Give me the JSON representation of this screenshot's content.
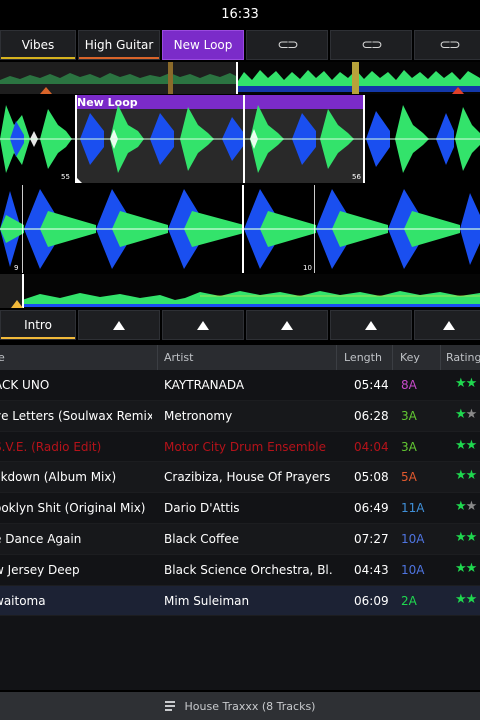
{
  "status": {
    "time": "16:33"
  },
  "cues": [
    {
      "label": "Vibes",
      "underline": "#d6b21e",
      "active": false,
      "loop": false
    },
    {
      "label": "High Guitar",
      "underline": "#d9642a",
      "active": false,
      "loop": false
    },
    {
      "label": "New Loop",
      "underline": "#9a4ae0",
      "active": true,
      "loop": false
    },
    {
      "label": "",
      "underline": "",
      "active": false,
      "loop": true
    },
    {
      "label": "",
      "underline": "",
      "active": false,
      "loop": true
    },
    {
      "label": "",
      "underline": "",
      "active": false,
      "loop": true
    }
  ],
  "waveform": {
    "loop_label": "New Loop",
    "beat_numbers_top": [
      "55",
      "56"
    ],
    "beat_numbers_bottom": [
      "9",
      "10"
    ]
  },
  "pads": [
    {
      "label": "Intro",
      "filled": true
    },
    {
      "label": "",
      "filled": false
    },
    {
      "label": "",
      "filled": false
    },
    {
      "label": "",
      "filled": false
    },
    {
      "label": "",
      "filled": false
    },
    {
      "label": "",
      "filled": false
    }
  ],
  "library": {
    "columns": {
      "title": "e",
      "artist": "Artist",
      "length": "Length",
      "key": "Key",
      "rating": "Rating"
    },
    "rows": [
      {
        "title": "ACK UNO",
        "artist": "KAYTRANADA",
        "length": "05:44",
        "key": "8A",
        "key_color": "#c64ac9",
        "rating": 2,
        "missing": false,
        "selected": false
      },
      {
        "title": "ve Letters (Soulwax Remix)",
        "artist": "Metronomy",
        "length": "06:28",
        "key": "3A",
        "key_color": "#62c733",
        "rating": 1,
        "missing": false,
        "selected": false
      },
      {
        "title": "S.V.E. (Radio Edit)",
        "artist": "Motor City Drum Ensemble",
        "length": "04:04",
        "key": "3A",
        "key_color": "#62c733",
        "rating": 2,
        "missing": true,
        "selected": false
      },
      {
        "title": "ckdown (Album Mix)",
        "artist": "Crazibiza, House Of Prayers",
        "length": "05:08",
        "key": "5A",
        "key_color": "#e0592e",
        "rating": 2,
        "missing": false,
        "selected": false
      },
      {
        "title": "ooklyn Shit (Original Mix)",
        "artist": "Dario D'Attis",
        "length": "06:49",
        "key": "11A",
        "key_color": "#3f8fd8",
        "rating": 1,
        "missing": false,
        "selected": false
      },
      {
        "title": "e Dance Again",
        "artist": "Black Coffee",
        "length": "07:27",
        "key": "10A",
        "key_color": "#4e74e0",
        "rating": 2,
        "missing": false,
        "selected": false
      },
      {
        "title": "w Jersey Deep",
        "artist": "Black Science Orchestra, Bl…",
        "length": "04:43",
        "key": "10A",
        "key_color": "#4e74e0",
        "rating": 2,
        "missing": false,
        "selected": false
      },
      {
        "title": "waitoma",
        "artist": "Mim Suleiman",
        "length": "06:09",
        "key": "2A",
        "key_color": "#1fd84f",
        "rating": 2,
        "missing": false,
        "selected": true
      }
    ]
  },
  "footer": {
    "label": "House Traxxx (8 Tracks)",
    "icon": "playlist-icon"
  },
  "colors": {
    "accent": "#7b2bc9",
    "star": "#1fd84f",
    "missing": "#b5131a",
    "waveform_green": "#33e36b",
    "waveform_blue": "#1a4ff0"
  }
}
